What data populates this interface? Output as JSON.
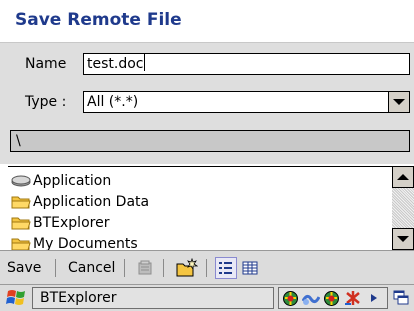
{
  "dialog": {
    "title": "Save Remote File"
  },
  "form": {
    "name_label": "Name",
    "name_value": "test.doc",
    "type_label": "Type :",
    "type_value": "All (*.*)",
    "path_value": "\\"
  },
  "files": [
    {
      "label": "Application",
      "icon": "drive-icon"
    },
    {
      "label": "Application Data",
      "icon": "folder-icon"
    },
    {
      "label": "BTExplorer",
      "icon": "folder-icon"
    },
    {
      "label": "My Documents",
      "icon": "folder-icon"
    }
  ],
  "menubar": {
    "save_label": "Save",
    "cancel_label": "Cancel",
    "icons": [
      "properties-icon",
      "new-folder-icon",
      "list-view-icon",
      "details-view-icon"
    ]
  },
  "taskbar": {
    "active_task": "BTExplorer",
    "start_icon": "windows-start-icon",
    "tray_icons": [
      "network-icon",
      "connection-icon",
      "network-icon",
      "bluetooth-icon"
    ],
    "desktop_icon": "show-desktop-icon"
  },
  "colors": {
    "title": "#1f3a8c",
    "form_bg": "#dedede",
    "folder": "#f4c542"
  }
}
